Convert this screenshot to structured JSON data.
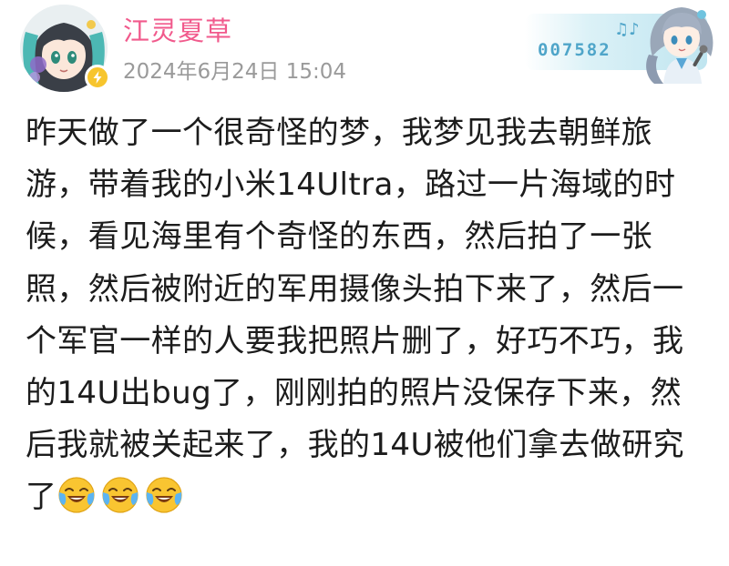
{
  "user": {
    "name": "江灵夏草",
    "timestamp": "2024年6月24日 15:04",
    "avatar_icon": "anime-avatar",
    "badge_icon": "lightning-vip-badge"
  },
  "decoration": {
    "number": "007582",
    "notes": "♫♪"
  },
  "post": {
    "lines": [
      "昨天做了一个很奇怪的梦，我梦见我去朝鲜旅",
      "游，带着我的小米14Ultra，路过一片海域的时",
      "候，看见海里有个奇怪的东西，然后拍了一张",
      "照，然后被附近的军用摄像头拍下来了，然后一",
      "个军官一样的人要我把照片删了，好巧不巧，我",
      "的14U出bug了，刚刚拍的照片没保存下来，然",
      "后我就被关起来了，我的14U被他们拿去做研究",
      "了"
    ],
    "emoji_icons": [
      "laughing-crying-emoji",
      "laughing-crying-emoji",
      "laughing-crying-emoji"
    ]
  },
  "colors": {
    "username": "#f15a8c",
    "timestamp": "#9a9a9a",
    "body_text": "#1c1c1c",
    "badge": "#f7c52d",
    "deco_accent": "#4fa5c9"
  }
}
